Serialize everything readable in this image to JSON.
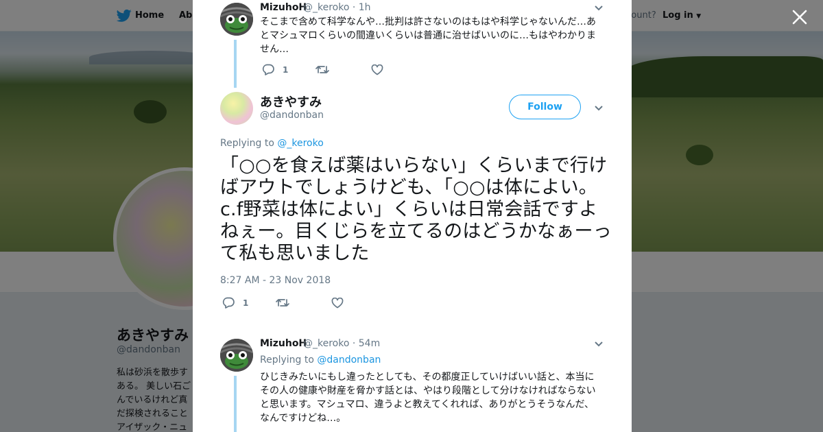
{
  "topbar": {
    "home_label": "Home",
    "about_label": "Abo",
    "account_prompt": "ccount?",
    "login_label": "Log in"
  },
  "profile": {
    "name": "あきやすみ",
    "handle": "@dandonban",
    "bio_lines": [
      "私は砂浜を散歩す",
      "ある。 美しい石ご",
      "んでいるけれど真",
      "だ探検されること",
      "アイザック・ニュ"
    ]
  },
  "tweets": [
    {
      "author": "MizuhoH",
      "handle": "@_keroko",
      "time": "· 1h",
      "text": "そこまで含めて科学なんや…批判は許さないのはもはや科学じゃないんだ…あとマシュマロくらいの間違いくらいは普通に治せばいいのに…もはやわかりません…",
      "reply_count": "1"
    },
    {
      "author": "あきやすみ",
      "handle": "@dandonban",
      "follow_label": "Follow",
      "replying_prefix": "Replying to",
      "replying_to": "@_keroko",
      "text": "「○○を食えば薬はいらない」くらいまで行けばアウトでしょうけども、「○○は体によい。c.f野菜は体によい」くらいは日常会話ですよねぇー。目くじらを立てるのはどうかなぁーって私も思いました",
      "timestamp": "8:27 AM - 23 Nov 2018",
      "reply_count": "1"
    },
    {
      "author": "MizuhoH",
      "handle": "@_keroko",
      "time": "· 54m",
      "replying_prefix": "Replying to",
      "replying_to": "@dandonban",
      "text": "ひじきみたいにもし違ったとしても、その都度正していけばいい話と、本当にその人の健康や財産を脅かす話とは、やはり段階として分けなければならないと思います。マシュマロ、違うよと教えてくれれば、ありがとうそうなんだ、なんですけどね…。"
    }
  ],
  "colors": {
    "accent": "#1da1f2",
    "link": "#1b95e0",
    "thread_line": "#a6d6f2",
    "muted": "#657786",
    "text": "#14171a"
  },
  "icons": [
    "twitter-bird-icon",
    "close-icon",
    "reply-icon",
    "retweet-icon",
    "like-icon",
    "chevron-down-icon"
  ]
}
